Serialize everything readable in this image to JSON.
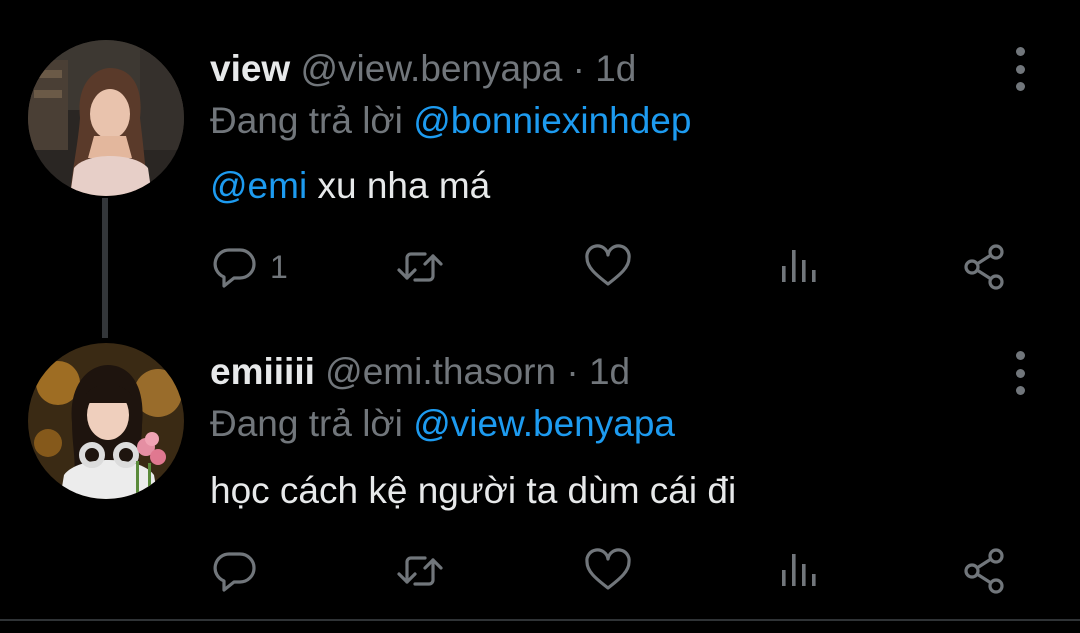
{
  "tweets": [
    {
      "name": "view",
      "handle": "@view.benyapa",
      "separator": "·",
      "time": "1d",
      "reply_prefix": "Đang trả lời",
      "reply_to": "@bonniexinhdep",
      "mention": "@emi",
      "text": " xu nha má",
      "reply_count": "1",
      "icons": [
        "reply-icon",
        "retweet-icon",
        "like-icon",
        "views-icon",
        "share-icon",
        "more-icon"
      ]
    },
    {
      "name": "emiiiii",
      "handle": "@emi.thasorn",
      "separator": "·",
      "time": "1d",
      "reply_prefix": "Đang trả lời",
      "reply_to": "@view.benyapa",
      "text": "học cách kệ người ta dùm cái đi",
      "reply_count": "",
      "icons": [
        "reply-icon",
        "retweet-icon",
        "like-icon",
        "views-icon",
        "share-icon",
        "more-icon"
      ]
    }
  ],
  "colors": {
    "background": "#000000",
    "text": "#e7e9ea",
    "secondary": "#71767b",
    "link": "#1d9bf0",
    "thread_line": "#333639"
  }
}
